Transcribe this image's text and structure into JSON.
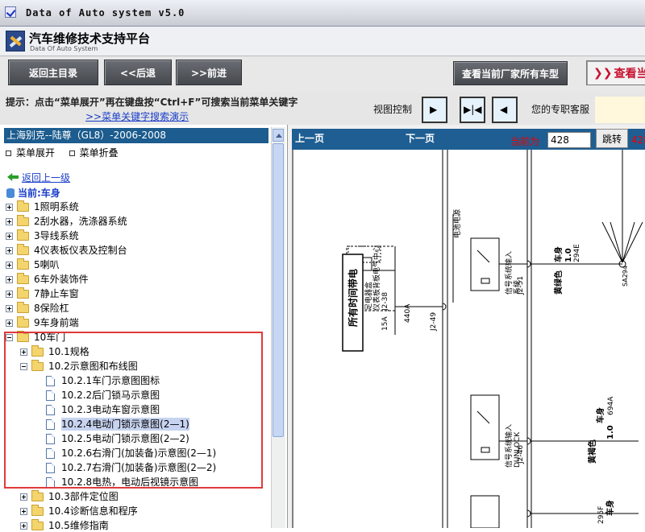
{
  "window": {
    "title": "Data of Auto system v5.0"
  },
  "header": {
    "title": "汽车维修技术支持平台",
    "subtitle": "Data Of Auto System"
  },
  "toolbar": {
    "home": "返回主目录",
    "back": "<<后退",
    "forward": ">>前进",
    "all_models": "查看当前厂家所有车型",
    "view_current": "查看当"
  },
  "hint": {
    "text": "提示：点击“菜单展开”再在键盘按“Ctrl+F”可搜索当前菜单关键字",
    "link": ">>菜单关键字搜索演示",
    "view_control": "视图控制",
    "support": "您的专职客服"
  },
  "tree": {
    "car_title": "上海别克--陆尊（GL8）-2006-2008",
    "expand": "菜单展开",
    "collapse": "菜单折叠",
    "back_up": "返回上一级",
    "current": "当前:车身",
    "items": [
      "1照明系统",
      "2刮水器，洗涤器系统",
      "3导线系统",
      "4仪表板仪表及控制台",
      "5喇叭",
      "6车外装饰件",
      "7静止车窗",
      "8保险杠",
      "9车身前端",
      "10车门"
    ],
    "door_children": [
      "10.1规格",
      "10.2示意图和布线图"
    ],
    "diagrams": [
      "10.2.1车门示意图图标",
      "10.2.2后门锁马示意图",
      "10.2.3电动车窗示意图",
      "10.2.4电动门锁示意图(2—1)",
      "10.2.5电动门锁示意图(2—2)",
      "10.2.6右滑门(加装备)示意图(2—1)",
      "10.2.7右滑门(加装备)示意图(2—2)",
      "10.2.8电热，电动后视镜示意图"
    ],
    "door_more": [
      "10.3部件定位图",
      "10.4诊断信息和程序",
      "10.5维修指南"
    ]
  },
  "viewer": {
    "prev": "上一页",
    "next": "下一页",
    "page_label": "当前为",
    "page_value": "428",
    "jump": "跳转",
    "total": "428"
  },
  "diagram_text": {
    "fuse_box": "所有时间带电",
    "fuse_desc1": "足电器盒",
    "fuse_desc2": "仪表板背板电气中心",
    "fuse_desc3": "J2-38",
    "fuse": "15A",
    "wire_440A": "440A",
    "connector1": "J2-49",
    "connector2": "J2-51",
    "connector3": "J2-46",
    "ground_label": "电池电源",
    "body1": "车身",
    "wire_color1": "黄绿色",
    "wire_size1": "1.0",
    "wire_num1": "294E",
    "body2": "车身",
    "wire_color2": "黄褐色",
    "wire_size2": "1.0",
    "wire_num2": "694A",
    "splice": "SA294",
    "wire_num3": "295F",
    "body3": "车身",
    "wire_color3": "黄褐色",
    "lock_out1": "信号系统输入",
    "lock_out1b": "系统",
    "lock_out2": "信号系统输入",
    "lock_out2b": "DUNLOCK"
  }
}
